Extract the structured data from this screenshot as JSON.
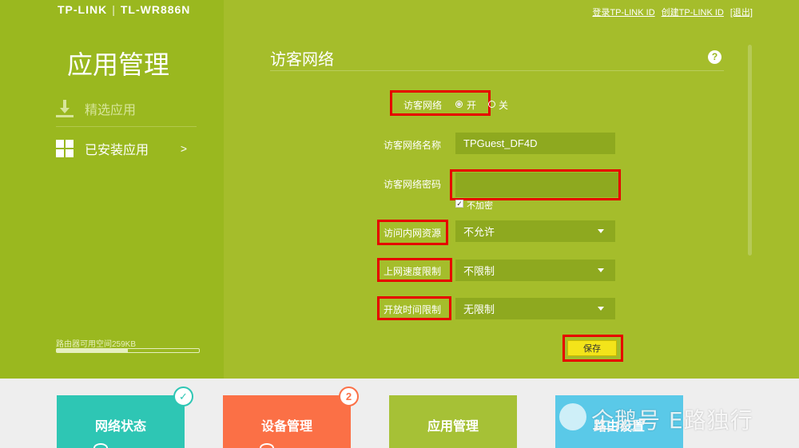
{
  "header": {
    "brand": "TP-LINK",
    "model": "TL-WR886N",
    "links": [
      "登录TP-LINK ID",
      "创建TP-LINK ID",
      "[退出]"
    ]
  },
  "sidebar": {
    "title": "应用管理",
    "items": [
      {
        "label": "精选应用",
        "icon": "download-icon"
      },
      {
        "label": "已安装应用",
        "icon": "grid-icon",
        "chevron": ">"
      }
    ],
    "storage_label": "路由器可用空间259KB",
    "storage_fraction": 0.5
  },
  "main": {
    "title": "访客网络",
    "help": "?",
    "guest_network": {
      "label": "访客网络",
      "on_label": "开",
      "off_label": "关",
      "selected": "开"
    },
    "ssid": {
      "label": "访客网络名称",
      "value": "TPGuest_DF4D"
    },
    "password": {
      "label": "访客网络密码",
      "value": "",
      "no_encrypt_label": "不加密",
      "no_encrypt_checked": true
    },
    "intranet": {
      "label": "访问内网资源",
      "value": "不允许"
    },
    "speed": {
      "label": "上网速度限制",
      "value": "不限制"
    },
    "time": {
      "label": "开放时间限制",
      "value": "无限制"
    },
    "save_label": "保存"
  },
  "bottom_tiles": [
    {
      "label": "网络状态",
      "badge": "✓"
    },
    {
      "label": "设备管理",
      "badge": "2"
    },
    {
      "label": "应用管理"
    },
    {
      "label": "路由设置"
    }
  ],
  "watermark": "企鹅号 E路独行",
  "colors": {
    "page_bg": "#a5bd2b",
    "sidebar_bg": "#9ab81f",
    "highlight": "#e60000",
    "save_button": "#f3e41a",
    "tile_network": "#2ec6b4",
    "tile_devices": "#fb7046",
    "tile_apps": "#a6c136",
    "tile_settings": "#5ac9e8"
  }
}
